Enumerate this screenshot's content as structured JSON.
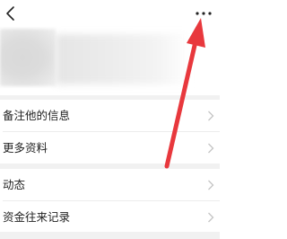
{
  "nav": {
    "back_icon": "chevron-left-icon",
    "more_icon": "ellipsis-icon"
  },
  "sections": [
    {
      "items": [
        {
          "label": "备注他的信息"
        },
        {
          "label": "更多资料"
        }
      ]
    },
    {
      "items": [
        {
          "label": "动态"
        },
        {
          "label": "资金往来记录"
        }
      ]
    }
  ],
  "annotation": {
    "color": "#e8383d",
    "target": "more-button"
  }
}
